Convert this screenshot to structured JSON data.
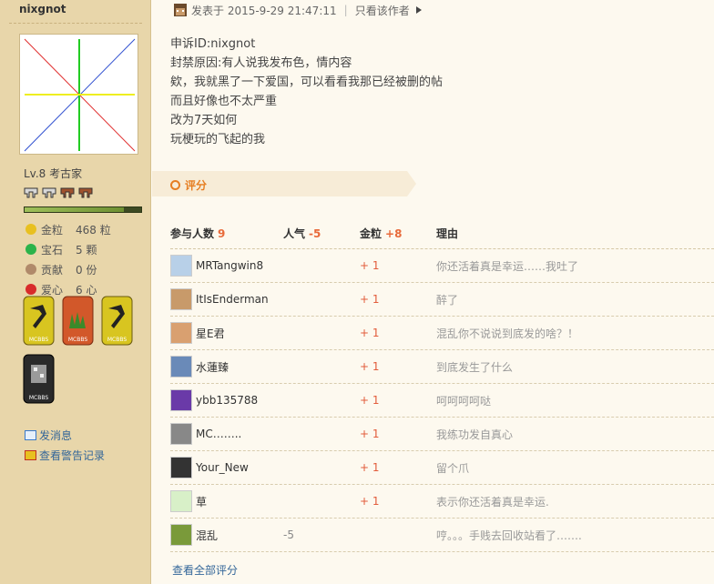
{
  "sidebar": {
    "username": "nixgnot",
    "level": "Lv.8 考古家",
    "xp_fraction": 0.85,
    "stats": [
      {
        "label": "金粒",
        "value": "468 粒",
        "icon": "gold-nugget-icon",
        "color": "#e8c020"
      },
      {
        "label": "宝石",
        "value": "5 颗",
        "icon": "gem-icon",
        "color": "#2bb34a"
      },
      {
        "label": "贡献",
        "value": "0 份",
        "icon": "contribution-icon",
        "color": "#b08a6a"
      },
      {
        "label": "爱心",
        "value": "6 心",
        "icon": "heart-icon",
        "color": "#d82b2b"
      }
    ],
    "badges": [
      {
        "label": "MCBBS",
        "color": "#d8c520"
      },
      {
        "label": "MCBBS",
        "color": "#d2582a"
      },
      {
        "label": "MCBBS",
        "color": "#d8c520"
      },
      {
        "label": "MCBBS",
        "color": "#2a2a2a"
      }
    ],
    "send_message": "发消息",
    "warning_log": "查看警告记录"
  },
  "post": {
    "published": "发表于 2015-9-29 21:47:11",
    "author_only": "只看该作者",
    "lines": [
      "申诉ID:nixgnot",
      "封禁原因:有人说我发布色，情内容",
      "欸，我就黑了一下爱国，可以看看我那已经被删的帖",
      "而且好像也不太严重",
      "改为7天如何",
      "玩梗玩的飞起的我"
    ]
  },
  "rating": {
    "label": "评分",
    "headers": {
      "participants": "参与人数",
      "participants_count": "9",
      "popularity": "人气",
      "popularity_value": "-5",
      "gold": "金粒",
      "gold_value": "+8",
      "reason": "理由"
    },
    "rows": [
      {
        "user": "MRTangwin8",
        "pop": "",
        "gold": "+ 1",
        "reason": "你还活着真是幸运……我吐了"
      },
      {
        "user": "ItIsEnderman",
        "pop": "",
        "gold": "+ 1",
        "reason": "醉了"
      },
      {
        "user": "星E君",
        "pop": "",
        "gold": "+ 1",
        "reason": "混乱你不说说到底发的啥？！"
      },
      {
        "user": "水蓮臻",
        "pop": "",
        "gold": "+ 1",
        "reason": "到底发生了什么"
      },
      {
        "user": "ybb135788",
        "pop": "",
        "gold": "+ 1",
        "reason": "呵呵呵呵哒"
      },
      {
        "user": "MC……..",
        "pop": "",
        "gold": "+ 1",
        "reason": "我练功发自真心"
      },
      {
        "user": "Your_New",
        "pop": "",
        "gold": "+ 1",
        "reason": "留个爪"
      },
      {
        "user": "草",
        "pop": "",
        "gold": "+ 1",
        "reason": "表示你还活着真是幸运."
      },
      {
        "user": "混乱",
        "pop": "-5",
        "gold": "",
        "reason": "哼。。。手贱去回收站看了……."
      }
    ],
    "view_all": "查看全部评分"
  }
}
